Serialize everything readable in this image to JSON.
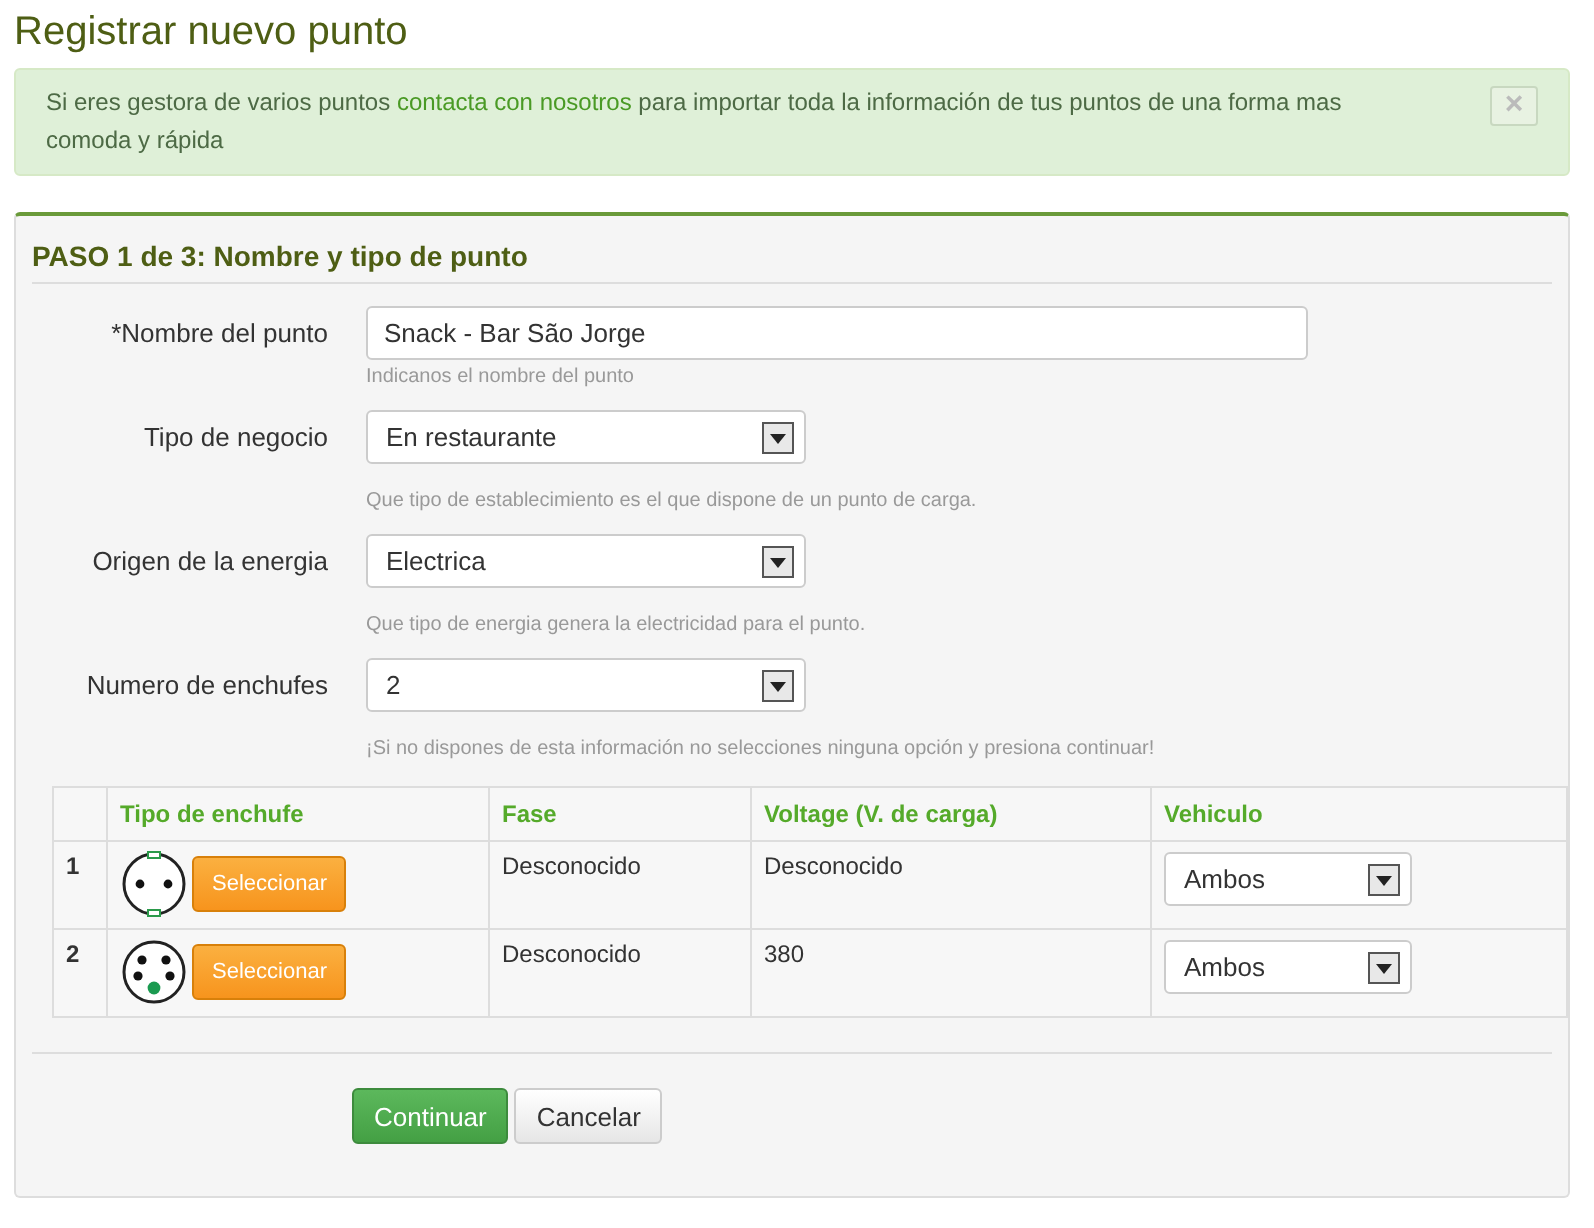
{
  "title": "Registrar nuevo punto",
  "alert": {
    "text_before": "Si eres gestora de varios puntos ",
    "link": "contacta con nosotros",
    "text_after": " para importar toda la información de tus puntos de una forma mas comoda y rápida",
    "close": "×"
  },
  "panel": {
    "heading": "PASO 1 de 3: Nombre y tipo de punto",
    "fields": [
      {
        "label": "*Nombre del punto",
        "kind": "text",
        "value": "Snack - Bar São Jorge",
        "help": "Indicanos el nombre del punto"
      },
      {
        "label": "Tipo de negocio",
        "kind": "select",
        "value": "En restaurante",
        "help": "Que tipo de establecimiento es el que dispone de un punto de carga."
      },
      {
        "label": "Origen de la energia",
        "kind": "select",
        "value": "Electrica",
        "help": "Que tipo de energia genera la electricidad para el punto."
      },
      {
        "label": "Numero de enchufes",
        "kind": "select",
        "value": "2",
        "help": "¡Si no dispones de esta información no selecciones ninguna opción y presiona continuar!"
      }
    ],
    "table": {
      "columns": [
        "Tipo de enchufe",
        "Fase",
        "Voltage (V. de carga)",
        "Vehiculo"
      ],
      "rows": [
        {
          "number": "1",
          "plug": {
            "kind": "two-pin"
          },
          "button": "Seleccionar",
          "fase": "Desconocido",
          "voltage": "Desconocido",
          "vehiculo": "Ambos"
        },
        {
          "number": "2",
          "plug": {
            "kind": "five-pin"
          },
          "button": "Seleccionar",
          "fase": "Desconocido",
          "voltage": "380",
          "vehiculo": "Ambos"
        }
      ]
    },
    "buttons": [
      {
        "label": "Continuar",
        "kind": "primary"
      },
      {
        "label": "Cancelar",
        "kind": "default"
      }
    ]
  }
}
